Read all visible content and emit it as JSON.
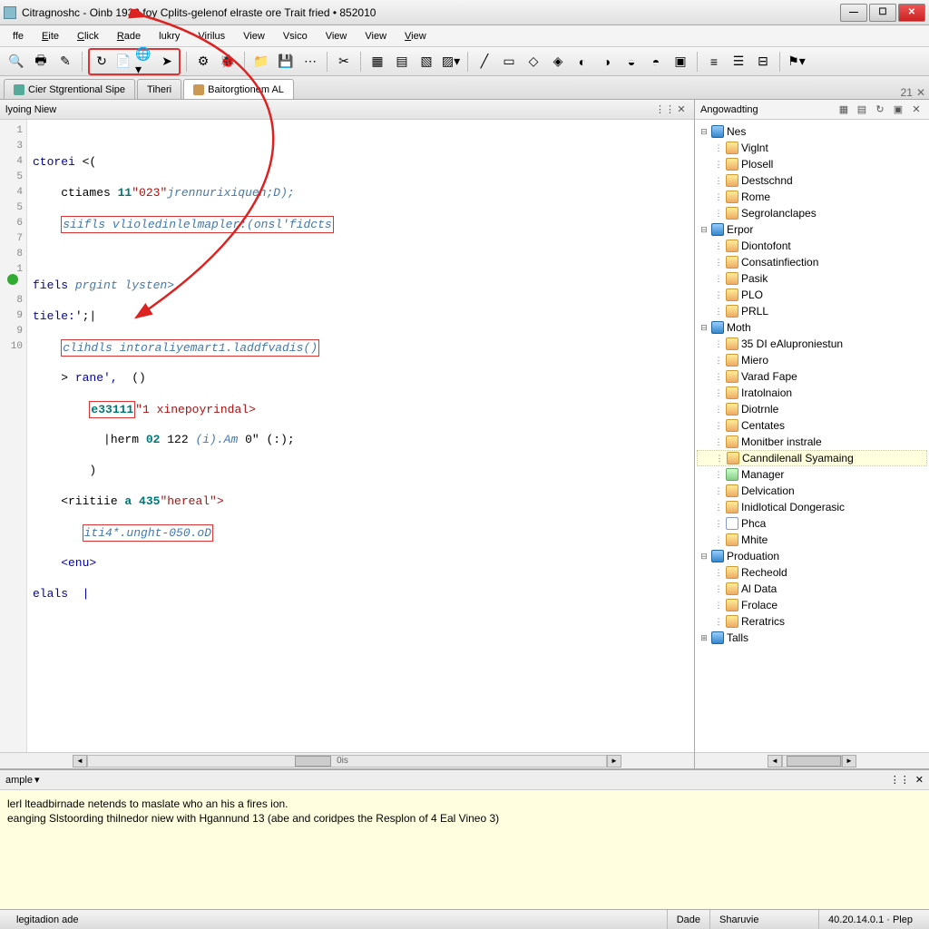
{
  "window": {
    "title": "Citragnoshc - Oinb 1930 foy Cplits-gelenof elraste ore Trait fried • 852010"
  },
  "menu": [
    "ffe",
    "Eite",
    "Click",
    "Rade",
    "lukry",
    "Virilus",
    "View",
    "Vsico",
    "View",
    "View",
    "View"
  ],
  "tabs": {
    "t1": "Cier Stgrentional Sipe",
    "t2": "Tiheri",
    "t3": "Baitorgtionem AL",
    "right_num": "21"
  },
  "editor": {
    "header": "lyoing Niew",
    "gutter": [
      "1",
      "3",
      "4",
      "5",
      "4",
      "5",
      "6",
      "7",
      "8",
      "1",
      "",
      "8",
      "9",
      "9",
      "10"
    ],
    "code": {
      "l1a": "ctorei",
      "l1b": " <(",
      "l2a": "    ctiames ",
      "l2b": "11",
      "l2c": "\"023\"",
      "l2d": "jrennurixiquen;D);",
      "l3a": "    ",
      "l3b": "siifls vlioledinlelmapler:(onsl'fidcts",
      "l4": "",
      "l5a": "fiels ",
      "l5b": "prgint lysten>",
      "l6a": "tiele:",
      "l6b": "';|",
      "l7a": "    ",
      "l7b": "clihdls intoraliyemart1.laddfvadis()",
      "l8a": "    > ",
      "l8b": "rane',",
      "l8c": "  ()",
      "l9a": "        ",
      "l9b": "e33111",
      "l9c": "\"1 xinepoyrindal>",
      "l10a": "          |herm ",
      "l10b": "02",
      "l10c": " 122 ",
      "l10d": "(i).Am",
      "l10e": " 0\" (:);",
      "l11": "        )",
      "l12a": "    <riitiie ",
      "l12b": "a 435",
      "l12c": "\"hereal\">",
      "l13a": "       ",
      "l13b": "iti4*.unght-050.oD",
      "l14": "    <enu>",
      "l15": "elals  |",
      "scroll_label": "0is"
    }
  },
  "side": {
    "title": "Angowadting",
    "tree": {
      "nes": {
        "label": "Nes",
        "children": [
          "Viglnt",
          "Plosell",
          "Destschnd",
          "Rome",
          "Segrolanclapes"
        ]
      },
      "erpor": {
        "label": "Erpor",
        "children": [
          "Diontofont",
          "Consatinfiection",
          "Pasik",
          "PLO",
          "PRLL"
        ]
      },
      "moth": {
        "label": "Moth",
        "children": [
          "35 DI eAluproniestun",
          "Miero",
          "Varad Fape",
          "Iratolnaion",
          "Diotrnle",
          "Centates",
          "Monitber instrale",
          "Canndilenall Syamaing",
          "Manager",
          "Delvication",
          "Inidlotical Dongerasic",
          "Phca",
          "Mhite"
        ]
      },
      "production": {
        "label": "Produation",
        "children": [
          "Recheold",
          "Al Data",
          "Frolace",
          "Reratrics"
        ]
      },
      "tails": {
        "label": "Talls"
      }
    }
  },
  "output": {
    "tab": "ample",
    "line1": "lerl lteadbirnade netends to maslate who an his a fires ion.",
    "line2": "eanging Slstoording thilnedor niew with Hgannund 13 (abe and coridpes the Resplon of 4 Eal Vineo 3)"
  },
  "status": {
    "file": "legitadion ade",
    "c1": "Dade",
    "c2": "Sharuvie",
    "c3": "40.20.14.0.1 · Plep"
  }
}
